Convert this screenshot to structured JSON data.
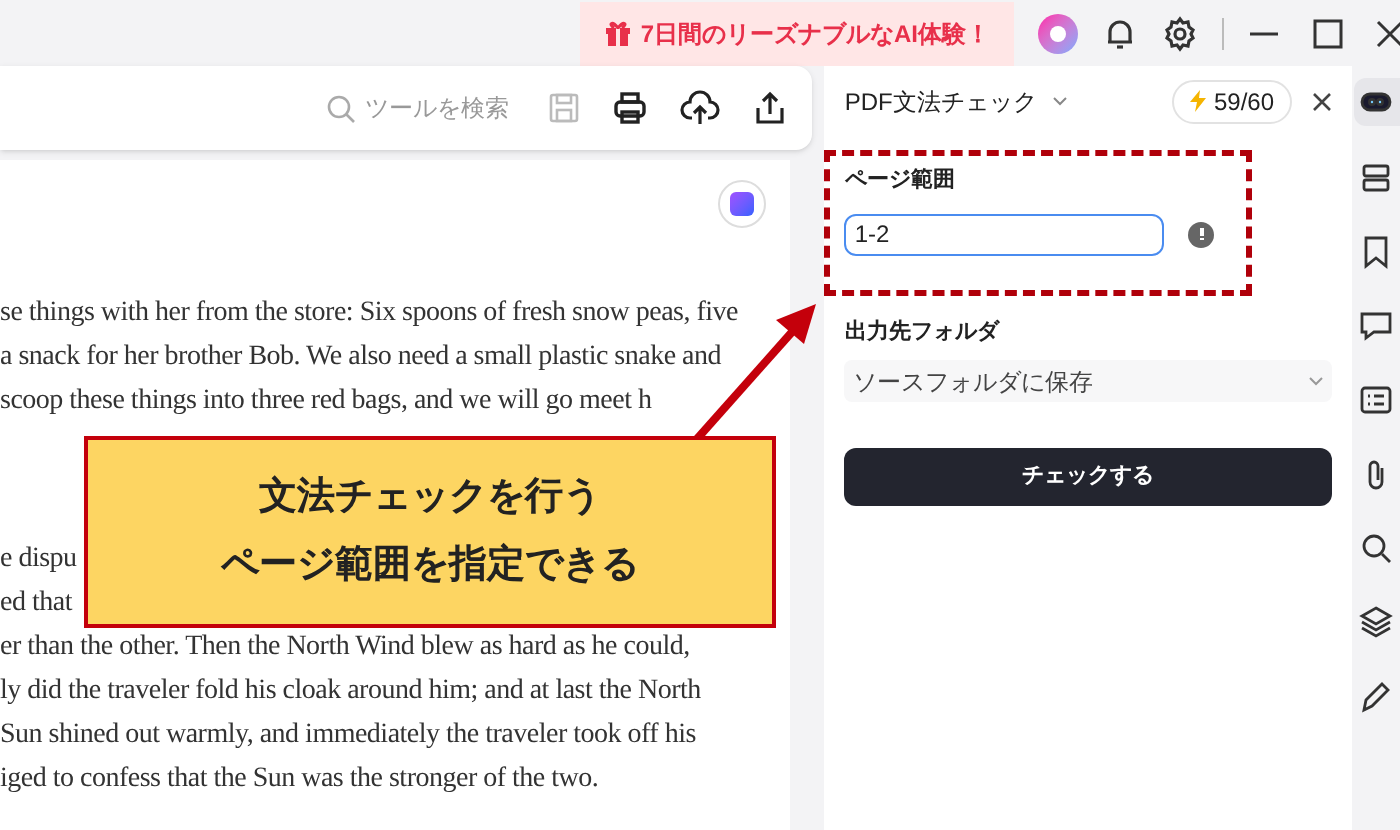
{
  "title_bar": {
    "promo": "7日間のリーズナブルなAI体験！"
  },
  "toolbar": {
    "search_placeholder": "ツールを検索"
  },
  "document": {
    "paragraphs": [
      [
        "se things with her from the store: Six spoons of fresh snow peas, five",
        "a snack for her brother Bob. We also need a small plastic snake and",
        "scoop these things into three red bags, and we will go meet h"
      ],
      [
        "e dispu",
        "ed that",
        "er than the other. Then the North Wind blew as hard as he could,",
        "ly did the traveler fold his cloak around him; and at last the North",
        "Sun shined out warmly, and immediately the traveler took off his",
        "iged to confess that the Sun was the stronger of the two."
      ]
    ]
  },
  "panel": {
    "title": "PDF文法チェック",
    "credits": "59/60",
    "page_range": {
      "label": "ページ範囲",
      "value": "1-2"
    },
    "output_folder": {
      "label": "出力先フォルダ",
      "value": "ソースフォルダに保存"
    },
    "button": "チェックする"
  },
  "side_toolbar": [
    {
      "selected": true
    },
    {
      "selected": false
    },
    {
      "selected": false
    },
    {
      "selected": false
    },
    {
      "selected": false
    },
    {
      "selected": false
    },
    {
      "selected": false
    },
    {
      "selected": false
    },
    {
      "selected": false
    }
  ],
  "annotation": {
    "callout_lines": [
      "文法チェックを行う",
      "ページ範囲を指定できる"
    ]
  }
}
